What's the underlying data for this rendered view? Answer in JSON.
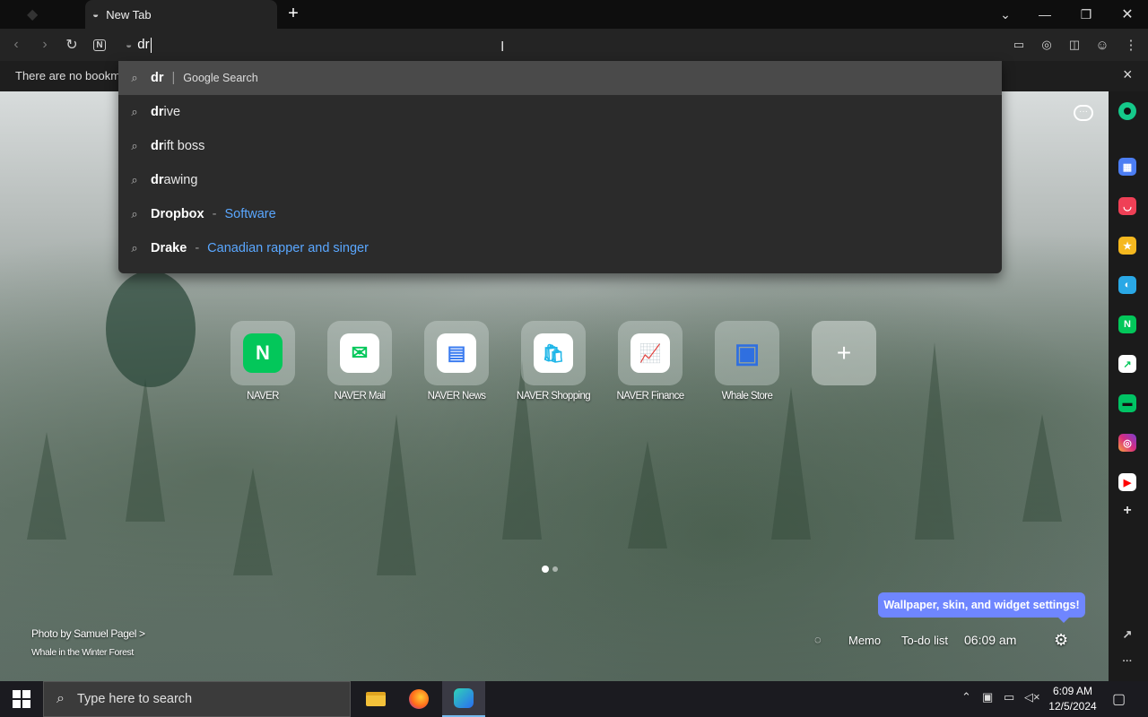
{
  "browser": {
    "tab_title": "New Tab",
    "new_tab_symbol": "+",
    "omnibox_text": "dr",
    "bookmarks_bar_text": "There are no bookmarks",
    "bookmarks_close": "×"
  },
  "suggestions": [
    {
      "bold": "dr",
      "rest": "",
      "sep": "|",
      "desc": "Google Search",
      "kind": "gs",
      "icon": "search-icon"
    },
    {
      "bold": "dr",
      "rest": "ive",
      "sep": "",
      "desc": "",
      "kind": "",
      "icon": "search-icon"
    },
    {
      "bold": "dr",
      "rest": "ift boss",
      "sep": "",
      "desc": "",
      "kind": "",
      "icon": "search-icon"
    },
    {
      "bold": "dr",
      "rest": "awing",
      "sep": "",
      "desc": "",
      "kind": "",
      "icon": "search-icon"
    },
    {
      "bold": "Dropbox",
      "rest": "",
      "sep": "-",
      "desc": "Software",
      "kind": "entity",
      "icon": "search-icon"
    },
    {
      "bold": "Drake",
      "rest": "",
      "sep": "-",
      "desc": "Canadian rapper and singer",
      "kind": "entity",
      "icon": "search-icon"
    }
  ],
  "shortcuts": [
    {
      "label": "NAVER",
      "color": "#03c75a",
      "glyph": "N"
    },
    {
      "label": "NAVER Mail",
      "color": "#ffffff",
      "glyph": "✉"
    },
    {
      "label": "NAVER News",
      "color": "#ffffff",
      "glyph": "▤"
    },
    {
      "label": "NAVER Shopping",
      "color": "#ffffff",
      "glyph": "🛍"
    },
    {
      "label": "NAVER Finance",
      "color": "#ffffff",
      "glyph": "📈"
    },
    {
      "label": "Whale Store",
      "color": "#3a66d8",
      "glyph": "▣"
    },
    {
      "label": "",
      "color": "transparent",
      "glyph": "+"
    }
  ],
  "wallpaper": {
    "credit": "Photo by Samuel Pagel",
    "credit_arrow": ">",
    "title": "Whale in the Winter Forest"
  },
  "widgets": {
    "memo": "Memo",
    "todo": "To-do list",
    "time": "06:09 am",
    "tooltip": "Wallpaper, skin, and widget settings!"
  },
  "taskbar": {
    "search_placeholder": "Type here to search",
    "clock_time": "6:09 AM",
    "clock_date": "12/5/2024"
  },
  "colors": {
    "accent": "#5aa7ff",
    "tooltip_bg": "#6f86ff",
    "naver_green": "#03c75a"
  }
}
